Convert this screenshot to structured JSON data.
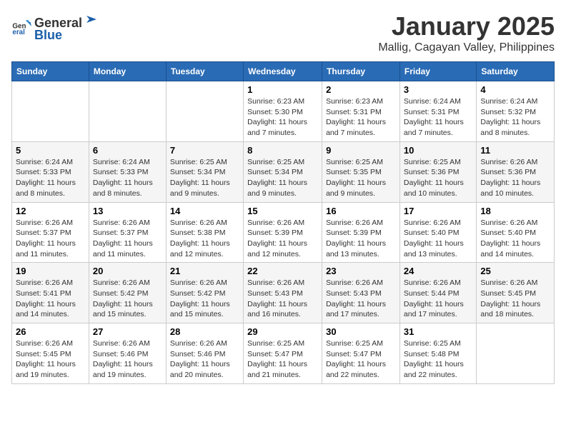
{
  "header": {
    "logo_general": "General",
    "logo_blue": "Blue",
    "month": "January 2025",
    "location": "Mallig, Cagayan Valley, Philippines"
  },
  "columns": [
    "Sunday",
    "Monday",
    "Tuesday",
    "Wednesday",
    "Thursday",
    "Friday",
    "Saturday"
  ],
  "weeks": [
    [
      {
        "day": "",
        "info": ""
      },
      {
        "day": "",
        "info": ""
      },
      {
        "day": "",
        "info": ""
      },
      {
        "day": "1",
        "info": "Sunrise: 6:23 AM\nSunset: 5:30 PM\nDaylight: 11 hours and 7 minutes."
      },
      {
        "day": "2",
        "info": "Sunrise: 6:23 AM\nSunset: 5:31 PM\nDaylight: 11 hours and 7 minutes."
      },
      {
        "day": "3",
        "info": "Sunrise: 6:24 AM\nSunset: 5:31 PM\nDaylight: 11 hours and 7 minutes."
      },
      {
        "day": "4",
        "info": "Sunrise: 6:24 AM\nSunset: 5:32 PM\nDaylight: 11 hours and 8 minutes."
      }
    ],
    [
      {
        "day": "5",
        "info": "Sunrise: 6:24 AM\nSunset: 5:33 PM\nDaylight: 11 hours and 8 minutes."
      },
      {
        "day": "6",
        "info": "Sunrise: 6:24 AM\nSunset: 5:33 PM\nDaylight: 11 hours and 8 minutes."
      },
      {
        "day": "7",
        "info": "Sunrise: 6:25 AM\nSunset: 5:34 PM\nDaylight: 11 hours and 9 minutes."
      },
      {
        "day": "8",
        "info": "Sunrise: 6:25 AM\nSunset: 5:34 PM\nDaylight: 11 hours and 9 minutes."
      },
      {
        "day": "9",
        "info": "Sunrise: 6:25 AM\nSunset: 5:35 PM\nDaylight: 11 hours and 9 minutes."
      },
      {
        "day": "10",
        "info": "Sunrise: 6:25 AM\nSunset: 5:36 PM\nDaylight: 11 hours and 10 minutes."
      },
      {
        "day": "11",
        "info": "Sunrise: 6:26 AM\nSunset: 5:36 PM\nDaylight: 11 hours and 10 minutes."
      }
    ],
    [
      {
        "day": "12",
        "info": "Sunrise: 6:26 AM\nSunset: 5:37 PM\nDaylight: 11 hours and 11 minutes."
      },
      {
        "day": "13",
        "info": "Sunrise: 6:26 AM\nSunset: 5:37 PM\nDaylight: 11 hours and 11 minutes."
      },
      {
        "day": "14",
        "info": "Sunrise: 6:26 AM\nSunset: 5:38 PM\nDaylight: 11 hours and 12 minutes."
      },
      {
        "day": "15",
        "info": "Sunrise: 6:26 AM\nSunset: 5:39 PM\nDaylight: 11 hours and 12 minutes."
      },
      {
        "day": "16",
        "info": "Sunrise: 6:26 AM\nSunset: 5:39 PM\nDaylight: 11 hours and 13 minutes."
      },
      {
        "day": "17",
        "info": "Sunrise: 6:26 AM\nSunset: 5:40 PM\nDaylight: 11 hours and 13 minutes."
      },
      {
        "day": "18",
        "info": "Sunrise: 6:26 AM\nSunset: 5:40 PM\nDaylight: 11 hours and 14 minutes."
      }
    ],
    [
      {
        "day": "19",
        "info": "Sunrise: 6:26 AM\nSunset: 5:41 PM\nDaylight: 11 hours and 14 minutes."
      },
      {
        "day": "20",
        "info": "Sunrise: 6:26 AM\nSunset: 5:42 PM\nDaylight: 11 hours and 15 minutes."
      },
      {
        "day": "21",
        "info": "Sunrise: 6:26 AM\nSunset: 5:42 PM\nDaylight: 11 hours and 15 minutes."
      },
      {
        "day": "22",
        "info": "Sunrise: 6:26 AM\nSunset: 5:43 PM\nDaylight: 11 hours and 16 minutes."
      },
      {
        "day": "23",
        "info": "Sunrise: 6:26 AM\nSunset: 5:43 PM\nDaylight: 11 hours and 17 minutes."
      },
      {
        "day": "24",
        "info": "Sunrise: 6:26 AM\nSunset: 5:44 PM\nDaylight: 11 hours and 17 minutes."
      },
      {
        "day": "25",
        "info": "Sunrise: 6:26 AM\nSunset: 5:45 PM\nDaylight: 11 hours and 18 minutes."
      }
    ],
    [
      {
        "day": "26",
        "info": "Sunrise: 6:26 AM\nSunset: 5:45 PM\nDaylight: 11 hours and 19 minutes."
      },
      {
        "day": "27",
        "info": "Sunrise: 6:26 AM\nSunset: 5:46 PM\nDaylight: 11 hours and 19 minutes."
      },
      {
        "day": "28",
        "info": "Sunrise: 6:26 AM\nSunset: 5:46 PM\nDaylight: 11 hours and 20 minutes."
      },
      {
        "day": "29",
        "info": "Sunrise: 6:25 AM\nSunset: 5:47 PM\nDaylight: 11 hours and 21 minutes."
      },
      {
        "day": "30",
        "info": "Sunrise: 6:25 AM\nSunset: 5:47 PM\nDaylight: 11 hours and 22 minutes."
      },
      {
        "day": "31",
        "info": "Sunrise: 6:25 AM\nSunset: 5:48 PM\nDaylight: 11 hours and 22 minutes."
      },
      {
        "day": "",
        "info": ""
      }
    ]
  ]
}
